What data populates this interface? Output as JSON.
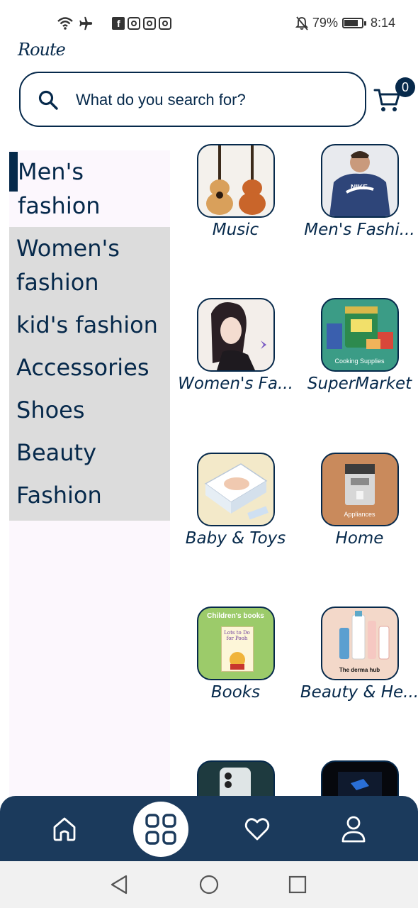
{
  "status_bar": {
    "battery": "79%",
    "time": "8:14",
    "icons": [
      "wifi-icon",
      "airplane-icon",
      "facebook-icon",
      "instagram-icon",
      "instagram-icon",
      "instagram-icon",
      "mute-icon",
      "battery-icon"
    ]
  },
  "app": {
    "logo_text": "Route"
  },
  "search": {
    "placeholder": "What do you search for?"
  },
  "cart": {
    "count": "0"
  },
  "sidebar": {
    "items": [
      {
        "label": "Men's fashion",
        "active": true
      },
      {
        "label": "Women's fashion",
        "active": false
      },
      {
        "label": "kid's fashion",
        "active": false
      },
      {
        "label": "Accessories",
        "active": false
      },
      {
        "label": "Shoes",
        "active": false
      },
      {
        "label": "Beauty",
        "active": false
      },
      {
        "label": "Fashion",
        "active": false
      }
    ]
  },
  "categories": [
    {
      "label": "Music",
      "image_icon": "guitar-icon"
    },
    {
      "label": "Men's Fashi...",
      "image_icon": "hoodie-icon"
    },
    {
      "label": "Women's Fa...",
      "image_icon": "woman-portrait-icon"
    },
    {
      "label": "SuperMarket",
      "image_icon": "grocery-icon",
      "image_caption": "Cooking Supplies"
    },
    {
      "label": "Baby & Toys",
      "image_icon": "diaper-icon"
    },
    {
      "label": "Home",
      "image_icon": "coffee-machine-icon",
      "image_caption": "Appliances"
    },
    {
      "label": "Books",
      "image_icon": "book-icon",
      "image_caption": "Children's books",
      "book_title": "Lots to Do for Pooh"
    },
    {
      "label": "Beauty & He...",
      "image_icon": "skincare-icon",
      "image_caption": "The derma hub"
    }
  ],
  "bottom_nav": {
    "items": [
      "home-icon",
      "categories-icon",
      "favorites-icon",
      "profile-icon"
    ],
    "active": "categories-icon"
  },
  "colors": {
    "primary": "#06294b",
    "nav_bg": "#1b3a5c",
    "sidebar_bg": "#dcdcdc",
    "sidebar_active_bg": "#fcf7fd"
  }
}
